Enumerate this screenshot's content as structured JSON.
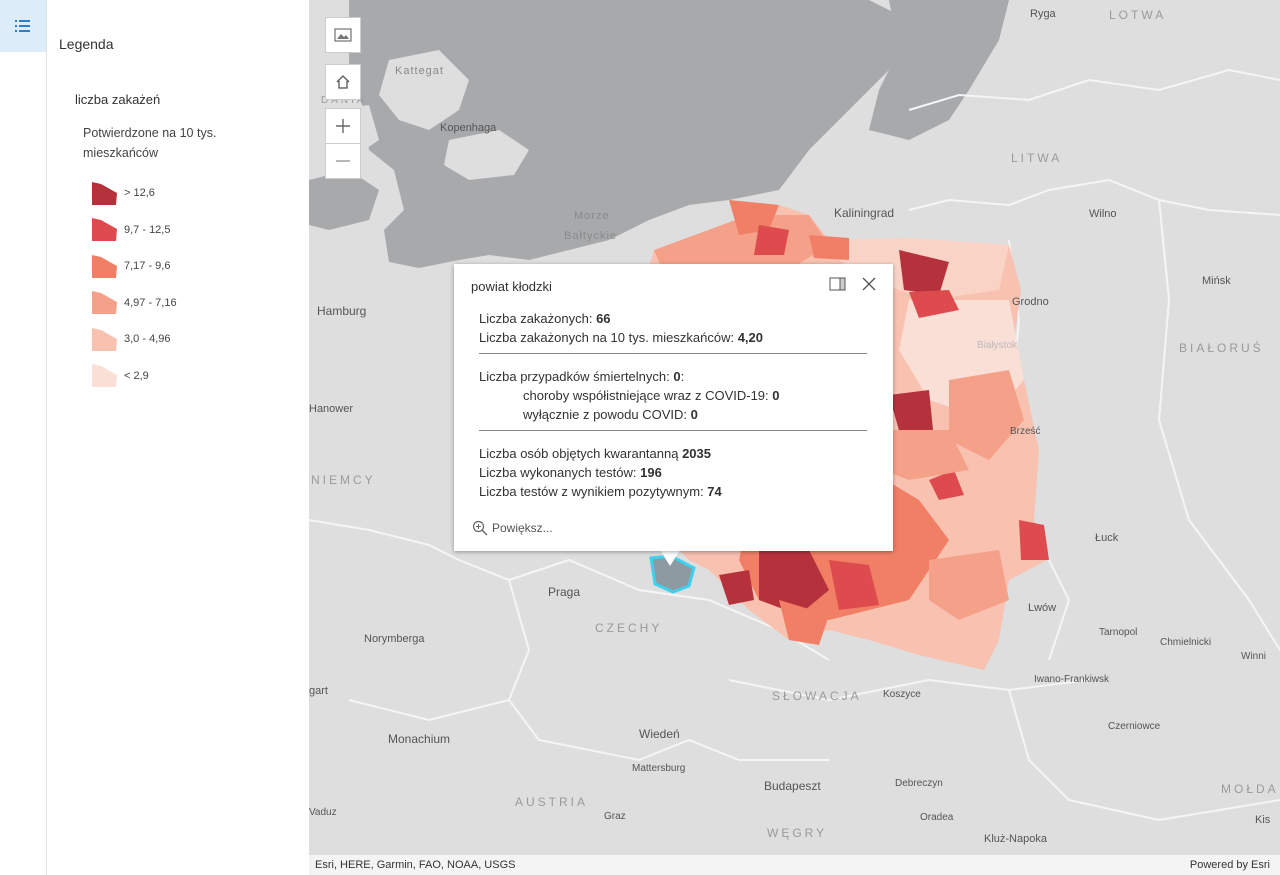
{
  "legend": {
    "title": "Legenda",
    "layer": "liczba zakażeń",
    "field": "Potwierdzone na 10 tys. mieszkańców",
    "classes": [
      {
        "label": "> 12,6",
        "color": "#b5323d"
      },
      {
        "label": "9,7 - 12,5",
        "color": "#dd4b4f"
      },
      {
        "label": "7,17 - 9,6",
        "color": "#f07f66"
      },
      {
        "label": "4,97 - 7,16",
        "color": "#f5a189"
      },
      {
        "label": "3,0 - 4,96",
        "color": "#f8c1b0"
      },
      {
        "label": "< 2,9",
        "color": "#fadfd6"
      }
    ]
  },
  "map": {
    "labels": {
      "ryga": "Ryga",
      "lotwa": "LOTWA",
      "kattegat": "Kattegat",
      "dania": "DANIA",
      "kopenhaga": "Kopenhaga",
      "litwa": "LITWA",
      "morze1": "Morze",
      "morze2": "Bałtyckie",
      "kaliningrad": "Kaliningrad",
      "wilno": "Wilno",
      "minsk": "Mińsk",
      "hamburg": "Hamburg",
      "grodno": "Grodno",
      "bialorus": "BIAŁORUŚ",
      "hanower": "Hanower",
      "brzesc": "Brześć",
      "niemcy": "NIEMCY",
      "luck": "Łuck",
      "praga": "Praga",
      "lwow": "Lwów",
      "czechy": "CZECHY",
      "norymberga": "Norymberga",
      "tarnopol": "Tarnopol",
      "chmielnicki": "Chmielnicki",
      "winnica": "Winni",
      "iwano": "Iwano-Frankiwsk",
      "stuttgart": "gart",
      "slowacja": "SŁOWACJA",
      "koszyce": "Koszyce",
      "czerniowce": "Czerniowce",
      "monachium": "Monachium",
      "wieden": "Wiedeń",
      "mattersburg": "Mattersburg",
      "budapeszt": "Budapeszt",
      "debreczyn": "Debreczyn",
      "moldawia": "MOŁDA",
      "austria": "AUSTRIA",
      "graz": "Graz",
      "oradea": "Oradea",
      "kiszy": "Kis",
      "wegry": "WĘGRY",
      "kluz": "Kluż-Napoka",
      "vaduz": "Vaduz",
      "bialystok": "Białystok"
    }
  },
  "popup": {
    "title": "powiat kłodzki",
    "cases_label": "Liczba zakażonych: ",
    "cases_value": "66",
    "cases_rate_label": "Liczba zakażonych na 10 tys. mieszkańców: ",
    "cases_rate_value": "4,20",
    "deaths_label": "Liczba przypadków śmiertelnych: ",
    "deaths_value": "0",
    "deaths_suffix": ":",
    "comorb_label": "choroby współistniejące wraz z COVID-19: ",
    "comorb_value": "0",
    "covid_only_label": "wyłącznie z powodu COVID: ",
    "covid_only_value": "0",
    "quarantine_label": "Liczba osób objętych kwarantanną ",
    "quarantine_value": "2035",
    "tests_label": "Liczba wykonanych testów: ",
    "tests_value": "196",
    "positive_label": "Liczba testów z wynikiem pozytywnym: ",
    "positive_value": "74",
    "zoom_label": "Powiększ..."
  },
  "attribution": {
    "left": "Esri, HERE, Garmin, FAO, NOAA, USGS",
    "right": "Powered by Esri"
  }
}
